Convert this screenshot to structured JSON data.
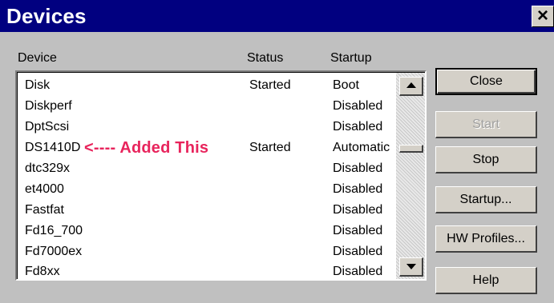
{
  "window": {
    "title": "Devices",
    "close_glyph": "×"
  },
  "columns": {
    "device": "Device",
    "status": "Status",
    "startup": "Startup"
  },
  "rows": [
    {
      "device": "Disk",
      "status": "Started",
      "startup": "Boot"
    },
    {
      "device": "Diskperf",
      "status": "",
      "startup": "Disabled"
    },
    {
      "device": "DptScsi",
      "status": "",
      "startup": "Disabled"
    },
    {
      "device": "DS1410D",
      "status": "Started",
      "startup": "Automatic",
      "annotation": "<---- Added This"
    },
    {
      "device": "dtc329x",
      "status": "",
      "startup": "Disabled"
    },
    {
      "device": "et4000",
      "status": "",
      "startup": "Disabled"
    },
    {
      "device": "Fastfat",
      "status": "",
      "startup": "Disabled"
    },
    {
      "device": "Fd16_700",
      "status": "",
      "startup": "Disabled"
    },
    {
      "device": "Fd7000ex",
      "status": "",
      "startup": "Disabled"
    },
    {
      "device": "Fd8xx",
      "status": "",
      "startup": "Disabled"
    }
  ],
  "buttons": {
    "close": "Close",
    "start": "Start",
    "stop": "Stop",
    "startup": "Startup...",
    "hw_profiles": "HW Profiles...",
    "help": "Help"
  },
  "scrollbar": {
    "position": 0.32
  },
  "colors": {
    "titlebar": "#010080",
    "annotation": "#e8245c",
    "dialog_face": "#c0c0c0"
  },
  "icons": {
    "scroll_up": "scroll-up-arrow-icon",
    "scroll_down": "scroll-down-arrow-icon",
    "close": "close-icon"
  }
}
